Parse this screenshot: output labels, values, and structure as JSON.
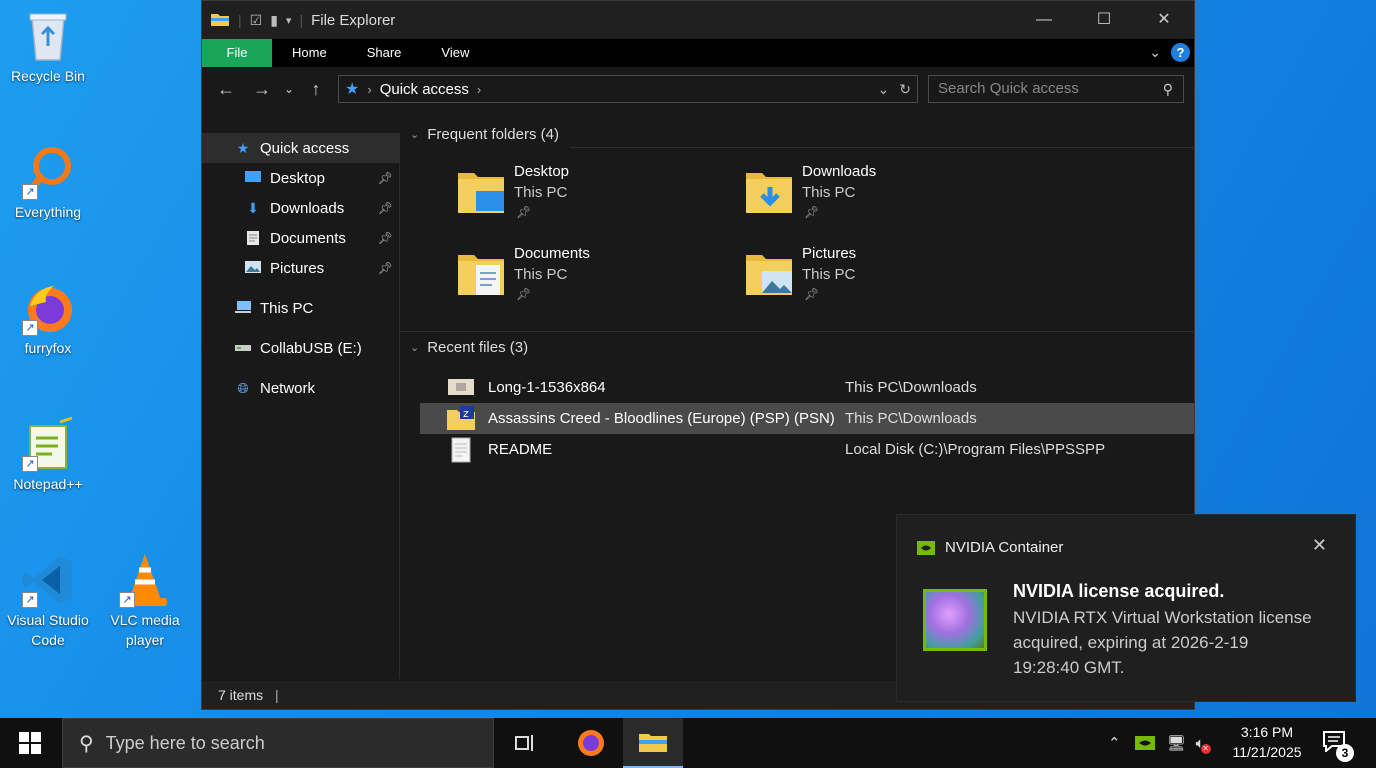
{
  "desktop": {
    "icons": [
      {
        "label": "Recycle Bin"
      },
      {
        "label": "Everything"
      },
      {
        "label": "furryfox"
      },
      {
        "label": "Notepad++"
      },
      {
        "label": "Visual Studio Code"
      },
      {
        "label": "VLC media player"
      }
    ]
  },
  "explorer": {
    "title": "File Explorer",
    "ribbon_tabs": [
      "File",
      "Home",
      "Share",
      "View"
    ],
    "address": {
      "location": "Quick access"
    },
    "search_placeholder": "Search Quick access",
    "sidebar": {
      "quick_access": "Quick access",
      "pinned": [
        "Desktop",
        "Downloads",
        "Documents",
        "Pictures"
      ],
      "this_pc": "This PC",
      "usb": "CollabUSB (E:)",
      "network": "Network"
    },
    "frequent": {
      "heading": "Frequent folders (4)",
      "folders": [
        {
          "name": "Desktop",
          "location": "This PC"
        },
        {
          "name": "Downloads",
          "location": "This PC"
        },
        {
          "name": "Documents",
          "location": "This PC"
        },
        {
          "name": "Pictures",
          "location": "This PC"
        }
      ]
    },
    "recent": {
      "heading": "Recent files (3)",
      "files": [
        {
          "name": "Long-1-1536x864",
          "path": "This PC\\Downloads"
        },
        {
          "name": "Assassins Creed - Bloodlines (Europe) (PSP) (PSN)",
          "path": "This PC\\Downloads"
        },
        {
          "name": "README",
          "path": "Local Disk (C:)\\Program Files\\PPSSPP"
        }
      ]
    },
    "status": "7 items"
  },
  "toast": {
    "app_name": "NVIDIA Container",
    "title": "NVIDIA license acquired.",
    "body": "NVIDIA RTX Virtual Workstation license acquired, expiring at 2026-2-19 19:28:40 GMT."
  },
  "taskbar": {
    "search_placeholder": "Type here to search",
    "time": "3:16 PM",
    "date": "11/21/2025",
    "notification_count": "3"
  },
  "colors": {
    "desktop_bg": "#1488e6",
    "file_tab": "#19a55a",
    "nvidia_green": "#76b900",
    "accent_blue": "#3fa0ff"
  }
}
